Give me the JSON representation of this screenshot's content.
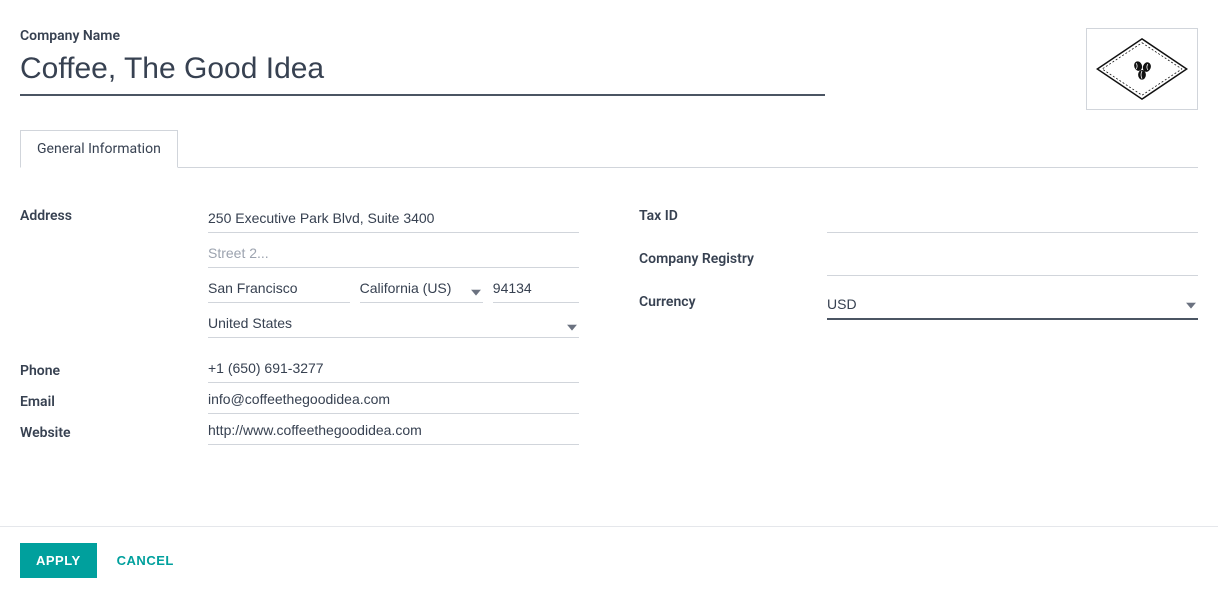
{
  "header": {
    "company_name_label": "Company Name",
    "company_name_value": "Coffee, The Good Idea"
  },
  "tabs": {
    "general_info": "General Information"
  },
  "left": {
    "address_label": "Address",
    "street1": "250 Executive Park Blvd, Suite 3400",
    "street2": "",
    "street2_placeholder": "Street 2...",
    "city": "San Francisco",
    "state": "California (US)",
    "zip": "94134",
    "country": "United States",
    "phone_label": "Phone",
    "phone": "+1 (650) 691-3277",
    "email_label": "Email",
    "email": "info@coffeethegoodidea.com",
    "website_label": "Website",
    "website": "http://www.coffeethegoodidea.com"
  },
  "right": {
    "tax_id_label": "Tax ID",
    "tax_id": "",
    "company_registry_label": "Company Registry",
    "company_registry": "",
    "currency_label": "Currency",
    "currency": "USD"
  },
  "footer": {
    "apply": "Apply",
    "cancel": "Cancel"
  }
}
